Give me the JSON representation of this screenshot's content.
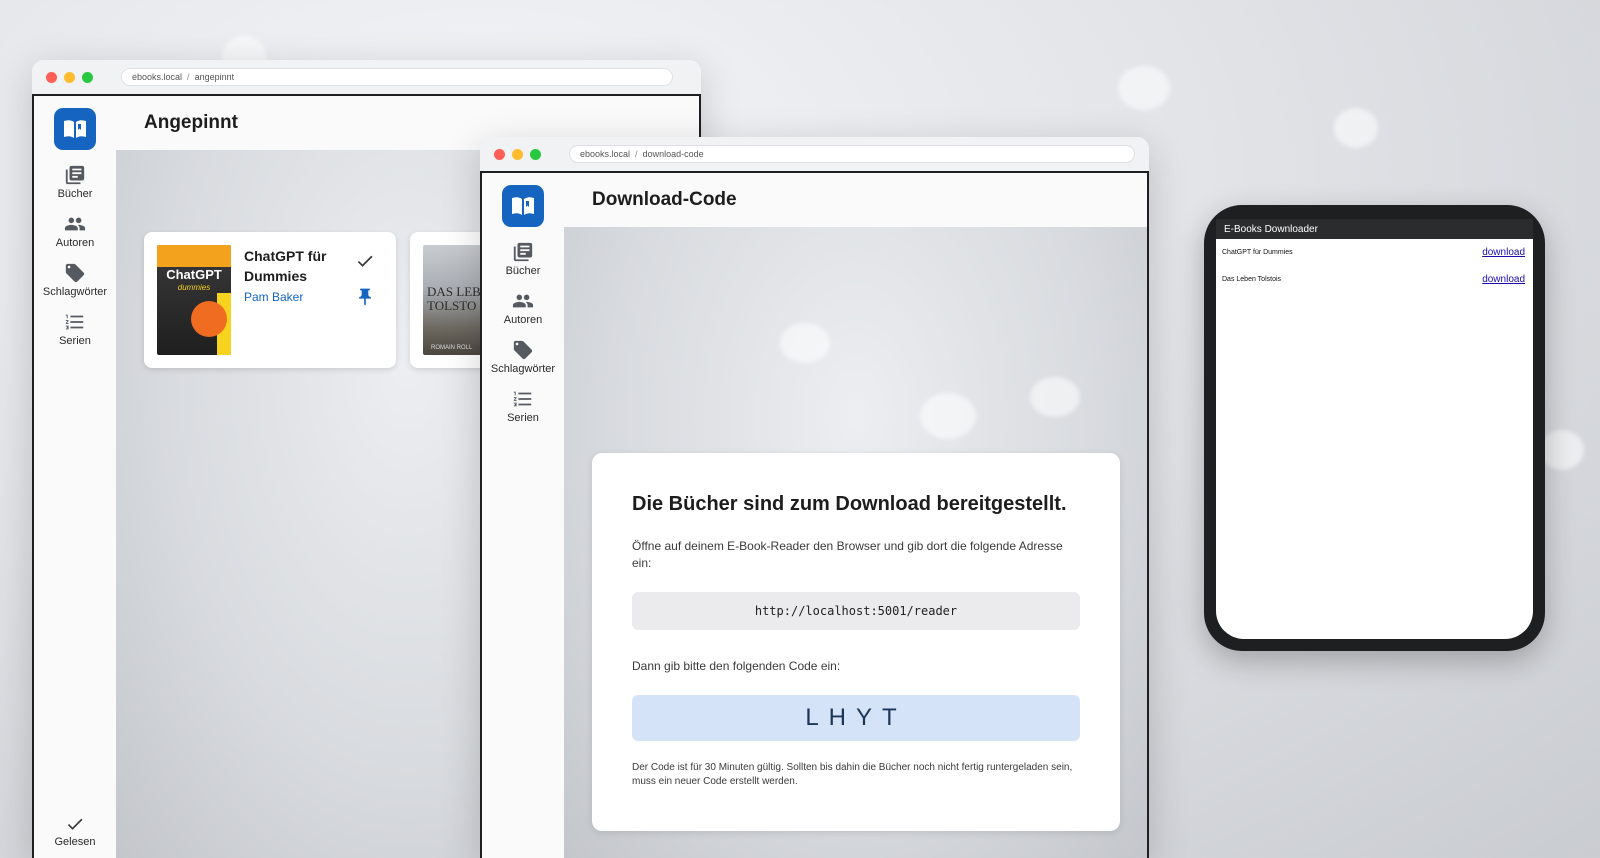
{
  "window1": {
    "url_host": "ebooks.local",
    "url_path": "angepinnt",
    "page_title": "Angepinnt",
    "nav": [
      {
        "label": "Bücher",
        "icon": "books-icon"
      },
      {
        "label": "Autoren",
        "icon": "people-icon"
      },
      {
        "label": "Schlagwörter",
        "icon": "tag-icon"
      },
      {
        "label": "Serien",
        "icon": "list-icon"
      }
    ],
    "bottom_label": "Gelesen",
    "books": [
      {
        "title": "ChatGPT für Dummies",
        "author": "Pam Baker",
        "cover_title": "ChatGPT",
        "cover_sub": "dummies"
      },
      {
        "cover_line1": "DAS LEB",
        "cover_line2": "TOLSTO",
        "cover_author": "ROMAIN ROLL"
      }
    ]
  },
  "window2": {
    "url_host": "ebooks.local",
    "url_path": "download-code",
    "page_title": "Download-Code",
    "nav": [
      {
        "label": "Bücher",
        "icon": "books-icon"
      },
      {
        "label": "Autoren",
        "icon": "people-icon"
      },
      {
        "label": "Schlagwörter",
        "icon": "tag-icon"
      },
      {
        "label": "Serien",
        "icon": "list-icon"
      }
    ],
    "card": {
      "heading": "Die Bücher sind zum Download bereitgestellt.",
      "instruction": "Öffne auf deinem E-Book-Reader den Browser und gib dort die folgende Adresse ein:",
      "url": "http://localhost:5001/reader",
      "code_instruction": "Dann gib bitte den folgenden Code ein:",
      "code": "LHYT",
      "note": "Der Code ist für 30 Minuten gültig. Sollten bis dahin die Bücher noch nicht fertig runtergeladen sein, muss ein neuer Code erstellt werden."
    }
  },
  "phone": {
    "header": "E-Books Downloader",
    "rows": [
      {
        "title": "ChatGPT für Dummies",
        "link": "download"
      },
      {
        "title": "Das Leben Tolstois",
        "link": "download"
      }
    ]
  },
  "colors": {
    "accent": "#1565c0",
    "code_bg": "#d5e3f8"
  }
}
